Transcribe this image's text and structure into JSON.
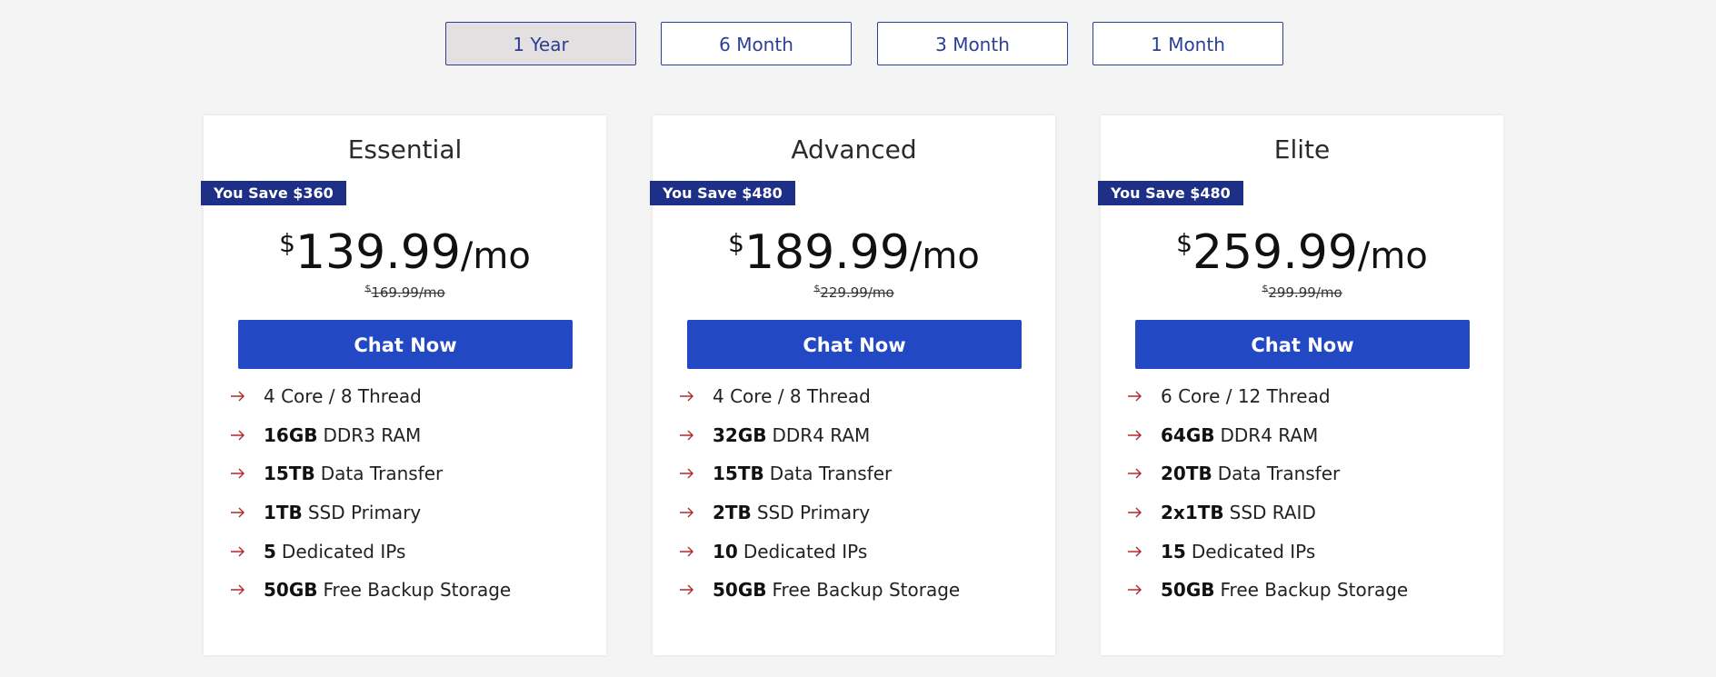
{
  "billing_tabs": [
    {
      "label": "1 Year",
      "active": true
    },
    {
      "label": "6 Month",
      "active": false
    },
    {
      "label": "3 Month",
      "active": false
    },
    {
      "label": "1 Month",
      "active": false
    }
  ],
  "plans": [
    {
      "name": "Essential",
      "savings": "You Save $360",
      "currency": "$",
      "price": "139.99",
      "period": "/mo",
      "old_currency": "$",
      "old_price": "169.99/mo",
      "cta": "Chat Now",
      "features": [
        {
          "bold": "",
          "text": "4 Core / 8 Thread"
        },
        {
          "bold": "16GB",
          "text": "DDR3 RAM"
        },
        {
          "bold": "15TB",
          "text": "Data Transfer"
        },
        {
          "bold": "1TB",
          "text": "SSD Primary"
        },
        {
          "bold": "5",
          "text": "Dedicated IPs"
        },
        {
          "bold": "50GB",
          "text": "Free Backup Storage"
        }
      ]
    },
    {
      "name": "Advanced",
      "savings": "You Save $480",
      "currency": "$",
      "price": "189.99",
      "period": "/mo",
      "old_currency": "$",
      "old_price": "229.99/mo",
      "cta": "Chat Now",
      "features": [
        {
          "bold": "",
          "text": "4 Core / 8 Thread"
        },
        {
          "bold": "32GB",
          "text": "DDR4 RAM"
        },
        {
          "bold": "15TB",
          "text": "Data Transfer"
        },
        {
          "bold": "2TB",
          "text": "SSD Primary"
        },
        {
          "bold": "10",
          "text": "Dedicated IPs"
        },
        {
          "bold": "50GB",
          "text": "Free Backup Storage"
        }
      ]
    },
    {
      "name": "Elite",
      "savings": "You Save $480",
      "currency": "$",
      "price": "259.99",
      "period": "/mo",
      "old_currency": "$",
      "old_price": "299.99/mo",
      "cta": "Chat Now",
      "features": [
        {
          "bold": "",
          "text": "6 Core / 12 Thread"
        },
        {
          "bold": "64GB",
          "text": "DDR4 RAM"
        },
        {
          "bold": "20TB",
          "text": "Data Transfer"
        },
        {
          "bold": "2x1TB",
          "text": "SSD RAID"
        },
        {
          "bold": "15",
          "text": "Dedicated IPs"
        },
        {
          "bold": "50GB",
          "text": "Free Backup Storage"
        }
      ]
    }
  ],
  "icons": {
    "feature_bullet": "arrow-right-icon"
  },
  "colors": {
    "accent": "#2348c4",
    "badge": "#1e2f87",
    "tab_border": "#2c3f94",
    "arrow": "#b0282c"
  }
}
